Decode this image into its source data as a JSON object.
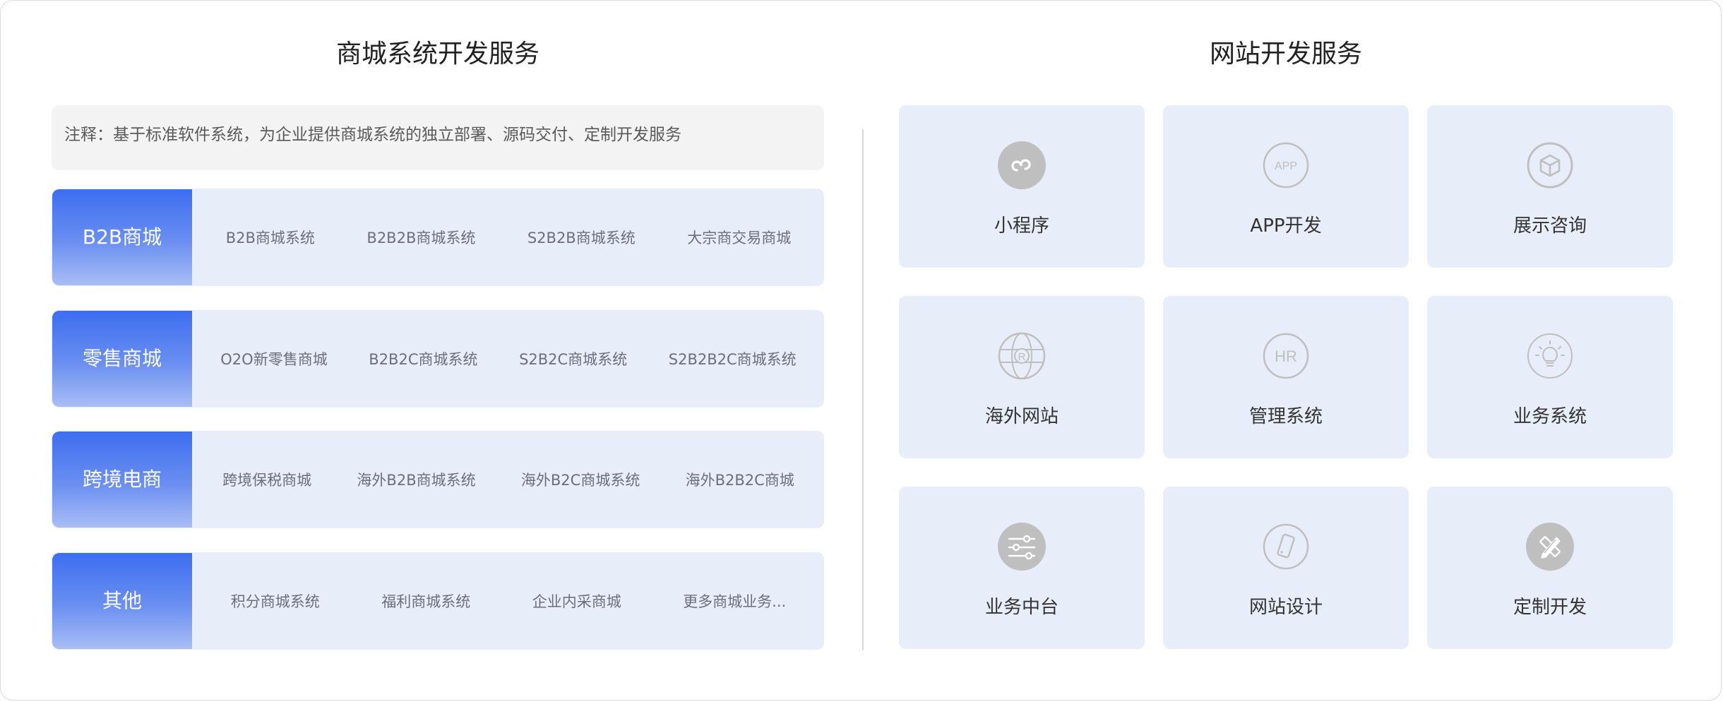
{
  "left": {
    "title": "商城系统开发服务",
    "note": "注释：基于标准软件系统，为企业提供商城系统的独立部署、源码交付、定制开发服务",
    "rows": [
      {
        "label": "B2B商城",
        "items": [
          "B2B商城系统",
          "B2B2B商城系统",
          "S2B2B商城系统",
          "大宗商交易商城"
        ]
      },
      {
        "label": "零售商城",
        "items": [
          "O2O新零售商城",
          "B2B2C商城系统",
          "S2B2C商城系统",
          "S2B2B2C商城系统"
        ]
      },
      {
        "label": "跨境电商",
        "items": [
          "跨境保税商城",
          "海外B2B商城系统",
          "海外B2C商城系统",
          "海外B2B2C商城"
        ]
      },
      {
        "label": "其他",
        "items": [
          "积分商城系统",
          "福利商城系统",
          "企业内采商城",
          "更多商城业务..."
        ]
      }
    ]
  },
  "right": {
    "title": "网站开发服务",
    "cards": [
      {
        "label": "小程序",
        "icon": "mini-program-icon"
      },
      {
        "label": "APP开发",
        "icon": "app-icon",
        "icon_text": "APP"
      },
      {
        "label": "展示咨询",
        "icon": "box-icon"
      },
      {
        "label": "海外网站",
        "icon": "globe-icon",
        "icon_text": "R"
      },
      {
        "label": "管理系统",
        "icon": "hr-icon",
        "icon_text": "HR"
      },
      {
        "label": "业务系统",
        "icon": "lightbulb-icon"
      },
      {
        "label": "业务中台",
        "icon": "sliders-icon"
      },
      {
        "label": "网站设计",
        "icon": "phone-icon"
      },
      {
        "label": "定制开发",
        "icon": "ruler-pencil-icon"
      }
    ]
  },
  "colors": {
    "accent": "#3c6ef0",
    "card_bg": "#e8edfa",
    "icon_gray": "#bfbfbf"
  }
}
